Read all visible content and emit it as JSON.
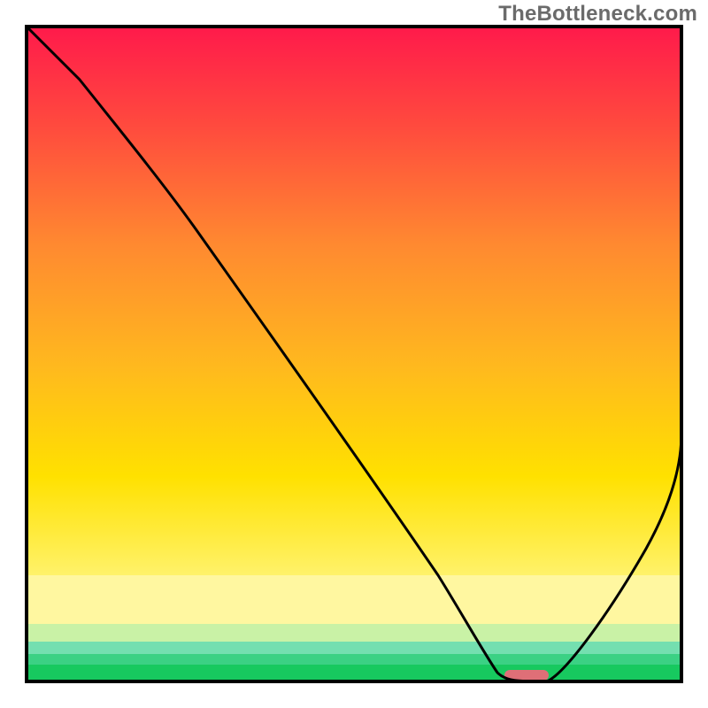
{
  "watermark": "TheBottleneck.com",
  "chart_data": {
    "type": "line",
    "title": "",
    "xlabel": "",
    "ylabel": "",
    "xlim": [
      0,
      100
    ],
    "ylim": [
      0,
      100
    ],
    "background_bands": [
      {
        "name": "gradient-red-yellow",
        "from": 4,
        "to": 83,
        "top_color": "#ff1a4b",
        "bottom_color": "#ffd400"
      },
      {
        "name": "pale-yellow",
        "from": 83,
        "to": 90,
        "color": "#fff7a0"
      },
      {
        "name": "pale-green",
        "from": 90,
        "to": 93,
        "color": "#d6f7b0"
      },
      {
        "name": "teal",
        "from": 93,
        "to": 95,
        "color": "#5fd7a8"
      },
      {
        "name": "green",
        "from": 95,
        "to": 97,
        "color": "#2ecf76"
      },
      {
        "name": "bright-green",
        "from": 97,
        "to": 99.5,
        "color": "#17c95f"
      }
    ],
    "series": [
      {
        "name": "bottleneck-curve",
        "x": [
          4,
          10,
          20,
          27,
          35,
          45,
          55,
          62,
          67,
          70,
          73,
          76,
          80,
          85,
          90,
          95,
          100
        ],
        "y": [
          100,
          92,
          80,
          72,
          62,
          49,
          35,
          24,
          15,
          8,
          3,
          0,
          0,
          6,
          15,
          26,
          38
        ]
      }
    ],
    "marker": {
      "x": 77,
      "y": 0.5,
      "width": 5,
      "height": 1.4,
      "color": "#e07a80",
      "name": "optimal-marker"
    },
    "colors": {
      "curve": "#000000",
      "outline": "#000000"
    }
  }
}
